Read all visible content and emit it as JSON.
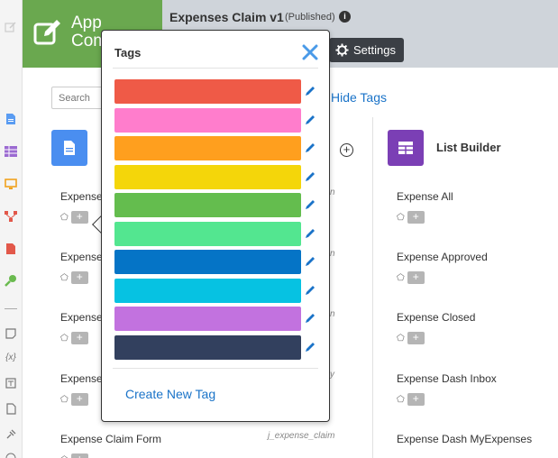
{
  "header": {
    "app_name": "App\nCom",
    "title": "Expenses Claim v1",
    "status": "(Published)",
    "settings_label": "Settings"
  },
  "toolbar": {
    "search_placeholder": "Search",
    "hide_tags_label": "Hide Tags"
  },
  "left_column": {
    "items": [
      "Expense",
      "Expense",
      "Expense",
      "Expense",
      "Expense Claim Form"
    ],
    "system_names": [
      "n",
      "n",
      "n",
      "y",
      "j_expense_claim"
    ]
  },
  "list_builder": {
    "title": "List Builder",
    "items": [
      "Expense All",
      "Expense Approved",
      "Expense Closed",
      "Expense Dash Inbox",
      "Expense Dash MyExpenses"
    ]
  },
  "tags_popover": {
    "title": "Tags",
    "create_label": "Create New Tag",
    "colors": [
      "#ef5a47",
      "#ff7dcc",
      "#ff9f1e",
      "#f4d60a",
      "#64bd4e",
      "#53e690",
      "#0574c6",
      "#06c2e2",
      "#c272df",
      "#32405e"
    ]
  },
  "icons": {
    "tag": "tag-icon",
    "plus": "+",
    "info": "i"
  }
}
